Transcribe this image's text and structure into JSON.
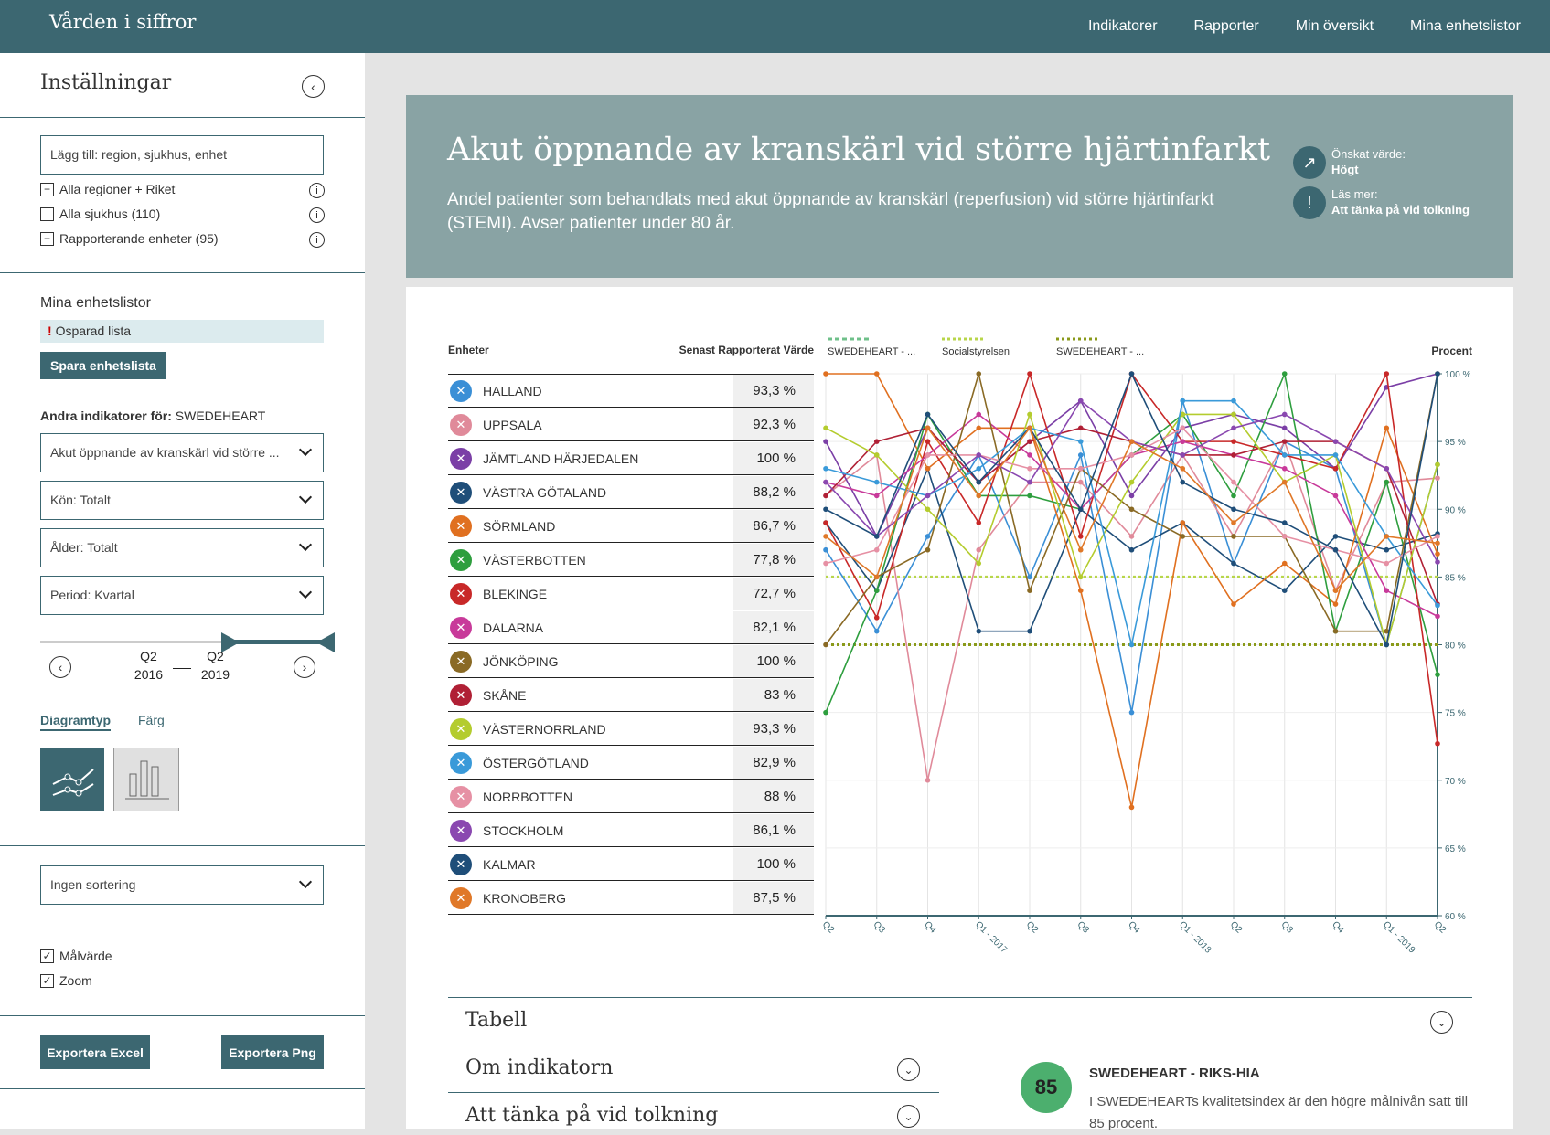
{
  "header": {
    "brand": "Vården i siffror",
    "nav": [
      "Indikatorer",
      "Rapporter",
      "Min översikt",
      "Mina enhetslistor"
    ]
  },
  "sidebar": {
    "title": "Inställningar",
    "search_placeholder": "Lägg till: region, sjukhus, enhet",
    "filters": [
      {
        "label": "Alla regioner + Riket",
        "state": "minus"
      },
      {
        "label": "Alla sjukhus (110)",
        "state": "empty"
      },
      {
        "label": "Rapporterande enheter (95)",
        "state": "minus"
      }
    ],
    "mylists_title": "Mina enhetslistor",
    "unsaved": "Osparad lista",
    "save_btn": "Spara enhetslista",
    "other_title": "Andra indikatorer för:",
    "other_source": "SWEDEHEART",
    "indicator_select": "Akut öppnande av kranskärl vid större ...",
    "kon_label": "Kön:",
    "kon_value": "Totalt",
    "alder_label": "Ålder:",
    "alder_value": "Totalt",
    "period_label": "Period:",
    "period_value": "Kvartal",
    "range": {
      "from_q": "Q2",
      "from_y": "2016",
      "to_q": "Q2",
      "to_y": "2019"
    },
    "tab_active": "Diagramtyp",
    "tab_other": "Färg",
    "sort_select": "Ingen sortering",
    "checks": [
      "Målvärde",
      "Zoom"
    ],
    "export_excel": "Exportera Excel",
    "export_png": "Exportera Png"
  },
  "banner": {
    "title": "Akut öppnande av kranskärl vid större hjärtinfarkt",
    "desc": "Andel patienter som behandlats med akut öppnande av kranskärl (reperfusion) vid större hjärtinfarkt (STEMI). Avser patienter under 80 år.",
    "desired_label": "Önskat värde:",
    "desired_value": "Högt",
    "read_label": "Läs mer:",
    "read_value": "Att tänka på vid tolkning"
  },
  "table": {
    "col_units": "Enheter",
    "col_value": "Senast Rapporterat Värde",
    "rows": [
      {
        "name": "HALLAND",
        "value": "93,3 %",
        "color": "#3a8fd6"
      },
      {
        "name": "UPPSALA",
        "value": "92,3 %",
        "color": "#e08a9a"
      },
      {
        "name": "JÄMTLAND HÄRJEDALEN",
        "value": "100 %",
        "color": "#7b3fa6"
      },
      {
        "name": "VÄSTRA GÖTALAND",
        "value": "88,2 %",
        "color": "#1f4e79"
      },
      {
        "name": "SÖRMLAND",
        "value": "86,7 %",
        "color": "#e07020"
      },
      {
        "name": "VÄSTERBOTTEN",
        "value": "77,8 %",
        "color": "#2e9e3e"
      },
      {
        "name": "BLEKINGE",
        "value": "72,7 %",
        "color": "#c82828"
      },
      {
        "name": "DALARNA",
        "value": "82,1 %",
        "color": "#c83a9a"
      },
      {
        "name": "JÖNKÖPING",
        "value": "100 %",
        "color": "#8a6a25"
      },
      {
        "name": "SKÅNE",
        "value": "83 %",
        "color": "#b02035"
      },
      {
        "name": "VÄSTERNORRLAND",
        "value": "93,3 %",
        "color": "#b4cc2e"
      },
      {
        "name": "ÖSTERGÖTLAND",
        "value": "82,9 %",
        "color": "#3a9ad9"
      },
      {
        "name": "NORRBOTTEN",
        "value": "88 %",
        "color": "#e690a4"
      },
      {
        "name": "STOCKHOLM",
        "value": "86,1 %",
        "color": "#8a48b0"
      },
      {
        "name": "KALMAR",
        "value": "100 %",
        "color": "#1f4e79"
      },
      {
        "name": "KRONOBERG",
        "value": "87,5 %",
        "color": "#e07828"
      }
    ]
  },
  "chart_data": {
    "type": "line",
    "ylabel": "Procent",
    "ylim": [
      60,
      100
    ],
    "yticks": [
      "100 %",
      "95 %",
      "90 %",
      "85 %",
      "80 %",
      "75 %",
      "70 %",
      "65 %",
      "60 %"
    ],
    "categories": [
      "Q2",
      "Q3",
      "Q4",
      "Q1 - 2017",
      "Q2",
      "Q3",
      "Q4",
      "Q1 - 2018",
      "Q2",
      "Q3",
      "Q4",
      "Q1 - 2019",
      "Q2"
    ],
    "reference_lines": [
      {
        "name": "SWEDEHEART - ...",
        "value": null,
        "color": "#6fc08a",
        "dash": "5,3"
      },
      {
        "name": "Socialstyrelsen",
        "value": 85,
        "color": "#b8d64a",
        "dash": "3,3"
      },
      {
        "name": "SWEDEHEART - ...",
        "value": 80,
        "color": "#8a9a1a",
        "dash": "3,3"
      }
    ],
    "series": [
      {
        "name": "HALLAND",
        "color": "#3a8fd6",
        "values": [
          87,
          81,
          88,
          94,
          85,
          94,
          75,
          98,
          86,
          95,
          93,
          80,
          93.3
        ]
      },
      {
        "name": "UPPSALA",
        "color": "#e08a9a",
        "values": [
          91,
          94,
          70,
          87,
          92,
          92,
          88,
          94,
          88,
          95,
          84,
          92,
          92.3
        ]
      },
      {
        "name": "JÄMTLAND HÄRJEDALEN",
        "color": "#7b3fa6",
        "values": [
          95,
          88,
          96,
          92,
          95,
          98,
          91,
          96,
          97,
          96,
          93,
          99,
          100
        ]
      },
      {
        "name": "VÄSTRA GÖTALAND",
        "color": "#1f4e79",
        "values": [
          89,
          84,
          93,
          81,
          81,
          90,
          87,
          89,
          86,
          84,
          88,
          87,
          88.2
        ]
      },
      {
        "name": "SÖRMLAND",
        "color": "#e07020",
        "values": [
          100,
          100,
          93,
          96,
          96,
          84,
          68,
          89,
          83,
          86,
          83,
          96,
          86.7
        ]
      },
      {
        "name": "VÄSTERBOTTEN",
        "color": "#2e9e3e",
        "values": [
          75,
          84,
          97,
          91,
          91,
          90,
          94,
          97,
          91,
          100,
          81,
          92,
          77.8
        ]
      },
      {
        "name": "BLEKINGE",
        "color": "#c82828",
        "values": [
          89,
          82,
          95,
          89,
          100,
          88,
          100,
          95,
          95,
          94,
          93,
          100,
          72.7
        ]
      },
      {
        "name": "DALARNA",
        "color": "#c83a9a",
        "values": [
          92,
          91,
          94,
          97,
          94,
          90,
          94,
          95,
          94,
          93,
          91,
          84,
          82.1
        ]
      },
      {
        "name": "JÖNKÖPING",
        "color": "#8a6a25",
        "values": [
          80,
          85,
          87,
          100,
          84,
          93,
          90,
          88,
          88,
          88,
          81,
          81,
          100
        ]
      },
      {
        "name": "SKÅNE",
        "color": "#b02035",
        "values": [
          91,
          95,
          96,
          92,
          95,
          96,
          95,
          94,
          94,
          95,
          95,
          93,
          83
        ]
      },
      {
        "name": "VÄSTERNORRLAND",
        "color": "#b4cc2e",
        "values": [
          96,
          94,
          90,
          86,
          97,
          85,
          92,
          97,
          97,
          92,
          94,
          80,
          93.3
        ]
      },
      {
        "name": "ÖSTERGÖTLAND",
        "color": "#3a9ad9",
        "values": [
          93,
          92,
          91,
          93,
          96,
          95,
          80,
          98,
          98,
          94,
          94,
          88,
          82.9
        ]
      },
      {
        "name": "NORRBOTTEN",
        "color": "#e690a4",
        "values": [
          86,
          87,
          94,
          94,
          93,
          93,
          94,
          96,
          92,
          88,
          87,
          86,
          88
        ]
      },
      {
        "name": "STOCKHOLM",
        "color": "#8a48b0",
        "values": [
          92,
          88,
          91,
          94,
          92,
          98,
          95,
          94,
          96,
          97,
          95,
          93,
          86.1
        ]
      },
      {
        "name": "KALMAR",
        "color": "#1f4e79",
        "values": [
          90,
          88,
          97,
          92,
          96,
          90,
          100,
          92,
          90,
          89,
          87,
          80,
          100
        ]
      },
      {
        "name": "KRONOBERG",
        "color": "#e07828",
        "values": [
          88,
          85,
          96,
          91,
          96,
          87,
          95,
          93,
          89,
          92,
          84,
          88,
          87.5
        ]
      }
    ]
  },
  "accordion": {
    "tabell": "Tabell",
    "om": "Om indikatorn",
    "tanka": "Att tänka på vid tolkning"
  },
  "target": {
    "value": "85",
    "source": "SWEDEHEART - RIKS-HIA",
    "text": "I SWEDEHEARTs kvalitetsindex är den högre målnivån satt till 85 procent."
  }
}
